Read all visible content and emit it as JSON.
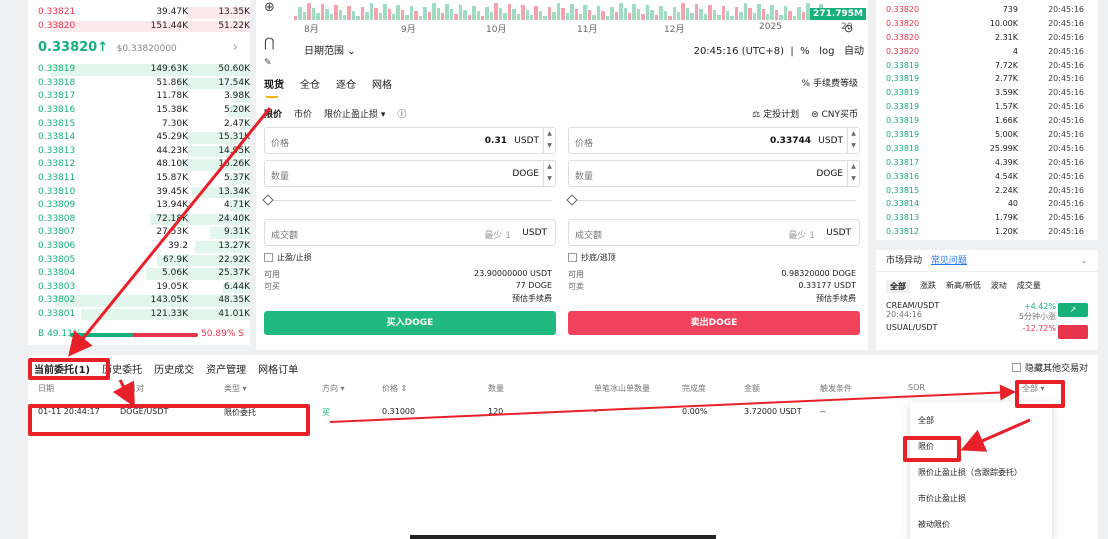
{
  "orderbook": {
    "asks": [
      {
        "price": "0.33821",
        "amount": "39.47K",
        "total": "13.35K",
        "depth": 0.29
      },
      {
        "price": "0.33820",
        "amount": "151.44K",
        "total": "51.22K",
        "depth": 0.9
      }
    ],
    "mid_price": "0.33820",
    "mid_arrow": "↑",
    "mid_usd": "$0.33820000",
    "bids": [
      {
        "price": "0.33819",
        "amount": "149.63K",
        "total": "50.60K",
        "depth": 0.9
      },
      {
        "price": "0.33818",
        "amount": "51.86K",
        "total": "17.54K",
        "depth": 0.33
      },
      {
        "price": "0.33817",
        "amount": "11.78K",
        "total": "3.98K",
        "depth": 0.08
      },
      {
        "price": "0.33816",
        "amount": "15.38K",
        "total": "5.20K",
        "depth": 0.1
      },
      {
        "price": "0.33815",
        "amount": "7.30K",
        "total": "2.47K",
        "depth": 0.05
      },
      {
        "price": "0.33814",
        "amount": "45.29K",
        "total": "15.31K",
        "depth": 0.29
      },
      {
        "price": "0.33813",
        "amount": "44.23K",
        "total": "14.95K",
        "depth": 0.28
      },
      {
        "price": "0.33812",
        "amount": "48.10K",
        "total": "16.26K",
        "depth": 0.31
      },
      {
        "price": "0.33811",
        "amount": "15.87K",
        "total": "5.37K",
        "depth": 0.1
      },
      {
        "price": "0.33810",
        "amount": "39.45K",
        "total": "13.34K",
        "depth": 0.26
      },
      {
        "price": "0.33809",
        "amount": "13.94K",
        "total": "4.71K",
        "depth": 0.09
      },
      {
        "price": "0.33808",
        "amount": "72.18K",
        "total": "24.40K",
        "depth": 0.45
      },
      {
        "price": "0.33807",
        "amount": "27.53K",
        "total": "9.31K",
        "depth": 0.18
      },
      {
        "price": "0.33806",
        "amount": "39.2",
        "total": "13.27K",
        "depth": 0.25
      },
      {
        "price": "0.33805",
        "amount": "6?.9K",
        "total": "22.92K",
        "depth": 0.42
      },
      {
        "price": "0.33804",
        "amount": "5.06K",
        "total": "25.37K",
        "depth": 0.47
      },
      {
        "price": "0.33803",
        "amount": "19.05K",
        "total": "6.44K",
        "depth": 0.12
      },
      {
        "price": "0.33802",
        "amount": "143.05K",
        "total": "48.35K",
        "depth": 0.88
      },
      {
        "price": "0.33801",
        "amount": "121.33K",
        "total": "41.01K",
        "depth": 0.76
      }
    ],
    "buy_label": "B",
    "buy_pct": "49.11%",
    "sell_pct": "50.89%",
    "sell_label": "S",
    "buy_ratio": 0.4911
  },
  "chart": {
    "last_price": "271.795M",
    "months": [
      "8月",
      "9月",
      "10月",
      "11月",
      "12月",
      "2025",
      "20"
    ],
    "date_range_label": "日期范围",
    "date_range_arrow": "⌄",
    "time": "20:45:16 (UTC+8)",
    "pct_label": "%",
    "log_label": "log",
    "auto_label": "自动"
  },
  "trade_form": {
    "tabs": [
      "现货",
      "全仓",
      "逐仓",
      "网格"
    ],
    "fee_label": "手续费等级",
    "fee_icon": "%",
    "order_types": [
      "限价",
      "市价",
      "限价止盈止损 ▾"
    ],
    "info_icon": "ⓘ",
    "dca_label": "定投计划",
    "cny_label": "CNY买币",
    "buy": {
      "price_label": "价格",
      "price_value": "0.31",
      "price_unit": "USDT",
      "qty_label": "数量",
      "qty_unit": "DOGE",
      "total_label": "成交额",
      "total_min": "最少 1",
      "total_unit": "USDT",
      "tp_label": "止盈/止损",
      "avail_label": "可用",
      "avail_value": "23.90000000 USDT",
      "can_label": "可买",
      "can_value": "77 DOGE",
      "fee_label": "预估手续费",
      "button": "买入DOGE"
    },
    "sell": {
      "price_label": "价格",
      "price_value": "0.33744",
      "price_unit": "USDT",
      "qty_label": "数量",
      "qty_unit": "DOGE",
      "total_label": "成交额",
      "total_min": "最少 1",
      "total_unit": "USDT",
      "tp_label": "抄底/逃顶",
      "avail_label": "可用",
      "avail_value": "0.98320000 DOGE",
      "can_label": "可卖",
      "can_value": "0.33177 USDT",
      "fee_label": "预估手续费",
      "button": "卖出DOGE"
    }
  },
  "trades": [
    {
      "p": "0.33820",
      "a": "739",
      "t": "20:45:16",
      "side": "red"
    },
    {
      "p": "0.33820",
      "a": "10.00K",
      "t": "20:45:16",
      "side": "red"
    },
    {
      "p": "0.33820",
      "a": "2.31K",
      "t": "20:45:16",
      "side": "red"
    },
    {
      "p": "0.33820",
      "a": "4",
      "t": "20:45:16",
      "side": "red"
    },
    {
      "p": "0.33819",
      "a": "7.72K",
      "t": "20:45:16",
      "side": "green"
    },
    {
      "p": "0.33819",
      "a": "2.77K",
      "t": "20:45:16",
      "side": "green"
    },
    {
      "p": "0.33819",
      "a": "3.59K",
      "t": "20:45:16",
      "side": "green"
    },
    {
      "p": "0.33819",
      "a": "1.57K",
      "t": "20:45:16",
      "side": "green"
    },
    {
      "p": "0.33819",
      "a": "1.66K",
      "t": "20:45:16",
      "side": "green"
    },
    {
      "p": "0.33819",
      "a": "5.00K",
      "t": "20:45:16",
      "side": "green"
    },
    {
      "p": "0.33818",
      "a": "25.99K",
      "t": "20:45:16",
      "side": "green"
    },
    {
      "p": "0.33817",
      "a": "4.39K",
      "t": "20:45:16",
      "side": "green"
    },
    {
      "p": "0.33816",
      "a": "4.54K",
      "t": "20:45:16",
      "side": "green"
    },
    {
      "p": "0.33815",
      "a": "2.24K",
      "t": "20:45:16",
      "side": "green"
    },
    {
      "p": "0.33814",
      "a": "40",
      "t": "20:45:16",
      "side": "green"
    },
    {
      "p": "0.33813",
      "a": "1.79K",
      "t": "20:45:16",
      "side": "green"
    },
    {
      "p": "0.33812",
      "a": "1.20K",
      "t": "20:45:16",
      "side": "green"
    }
  ],
  "market": {
    "title": "市场异动",
    "link": "常见问题",
    "expand_icon": "⌄",
    "tabs": [
      "全部",
      "涨跌",
      "新高/新低",
      "波动",
      "成交量"
    ],
    "rows": [
      {
        "pair": "CREAM/USDT",
        "time": "20:44:16",
        "chg": "+4.42%",
        "desc": "5分钟小涨",
        "tag": "↗",
        "color": "#16b07a"
      },
      {
        "pair": "USUAL/USDT",
        "time": "",
        "chg": "-12.72%",
        "desc": "",
        "tag": "",
        "color": "#e8354c"
      }
    ]
  },
  "orders": {
    "tabs": [
      "当前委托(1)",
      "历史委托",
      "历史成交",
      "资产管理",
      "网格订单"
    ],
    "hide_other": "隐藏其他交易对",
    "headers": [
      "日期",
      "交易对",
      "类型 ▾",
      "方向 ▾",
      "价格 ⇕",
      "数量",
      "单笔冰山单数量",
      "完成度",
      "金额",
      "触发条件",
      "SOR",
      "全部 ▾"
    ],
    "row": {
      "date": "01-11 20:44:17",
      "pair": "DOGE/USDT",
      "type": "限价委托",
      "side": "买",
      "price": "0.31000",
      "qty": "120",
      "iceberg": "-",
      "fill": "0.00%",
      "amount": "3.72000 USDT",
      "trigger": "--"
    },
    "filter_options": [
      "全部",
      "限价",
      "限价止盈止损（含跟踪委托）",
      "市价止盈止损",
      "被动限价"
    ]
  }
}
